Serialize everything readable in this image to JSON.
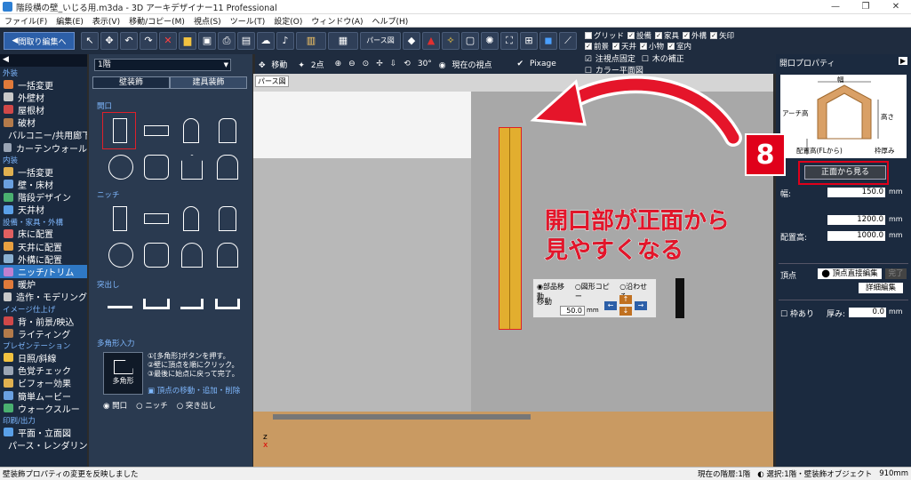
{
  "window": {
    "title": "階段横の壁_いじる用.m3da - 3D アーキデザイナー11 Professional",
    "controls": [
      "—",
      "❐",
      "✕"
    ]
  },
  "menu": [
    "ファイル(F)",
    "編集(E)",
    "表示(V)",
    "移動/コピー(M)",
    "視点(S)",
    "ツール(T)",
    "設定(O)",
    "ウィンドウ(A)",
    "ヘルプ(H)"
  ],
  "toolbar": {
    "back_label": "間取り編集へ",
    "view_mode": "パース図",
    "checkboxes_row1": [
      "グリッド",
      "設備",
      "家具",
      "外構",
      "矢印"
    ],
    "checkboxes_row2": [
      "前景",
      "天井",
      "小物",
      "室内"
    ]
  },
  "leftnav": {
    "categories": [
      {
        "label": "外装",
        "items": [
          "一括変更",
          "外壁材",
          "屋根材",
          "破材",
          "バルコニー/共用廊下",
          "カーテンウォール"
        ]
      },
      {
        "label": "内装",
        "items": [
          "一括変更",
          "壁・床材",
          "階段デザイン",
          "天井材"
        ]
      },
      {
        "label": "設備・家具・外構",
        "items": [
          "床に配置",
          "天井に配置",
          "外構に配置",
          "ニッチ/トリム",
          "暖炉",
          "造作・モデリング"
        ]
      },
      {
        "label": "イメージ仕上げ",
        "items": [
          "背・前景/映込",
          "ライティング"
        ]
      },
      {
        "label": "プレゼンテーション",
        "items": [
          "日照/斜線",
          "色覚チェック",
          "ビフォー効果",
          "簡単ムービー",
          "ウォークスルー"
        ]
      },
      {
        "label": "印刷/出力",
        "items": [
          "平面・立面図",
          "パース・レンダリング"
        ]
      }
    ],
    "selected": "ニッチ/トリム"
  },
  "panel": {
    "floor": "1階",
    "tabs": [
      "壁装飾",
      "建具装飾"
    ],
    "sec_opening": "開口",
    "sec_niche": "ニッチ",
    "sec_protrude": "突出し",
    "sec_polygon": "多角形入力",
    "polygon_btn": "多角形",
    "polygon_help": [
      "①[多角形]ボタンを押す。",
      "②壁に頂点を順にクリック。",
      "③最後に始点に戻って完了。"
    ],
    "vertex_edit": "頂点の移動・追加・削除",
    "radio": [
      "開口",
      "ニッチ",
      "突き出し"
    ]
  },
  "ribbon": {
    "items": [
      "移動",
      "2点",
      "現在の視点",
      "Pixage"
    ],
    "angle": "30°",
    "checks": [
      "注視点固定",
      "カラー平面図",
      "木の補正"
    ]
  },
  "viewport": {
    "label": "パース図",
    "move_panel": {
      "radios": [
        "部品移動",
        "図形コピー",
        "沿わせる"
      ],
      "label": "移動",
      "value": "50.0",
      "unit": "mm"
    },
    "axis": [
      "x",
      "z"
    ]
  },
  "right": {
    "header": "開口プロパティ",
    "diagram_labels": [
      "幅",
      "高さ",
      "アーチ高",
      "配置高(FLから)",
      "枠厚み"
    ],
    "front_btn": "正面から見る",
    "width_label": "幅:",
    "width_val": "150.0",
    "height_val": "1200.0",
    "fl_label": "配置高:",
    "fl_val": "1000.0",
    "unit": "mm",
    "vertex_label": "頂点",
    "vertex_btn": "頂点直接編集",
    "done": "完了",
    "detail_btn": "詳細編集",
    "frame_chk": "枠あり",
    "thick_label": "厚み:",
    "thick_val": "0.0"
  },
  "annotation": {
    "step": "8",
    "line1": "開口部が正面から",
    "line2": "見やすくなる",
    "color": "#e5152a"
  },
  "status": {
    "left": "壁装飾プロパティの変更を反映しました",
    "floor": "現在の階層:1階",
    "selection": "選択:1階・壁装飾オブジェクト",
    "size": "910mm"
  }
}
